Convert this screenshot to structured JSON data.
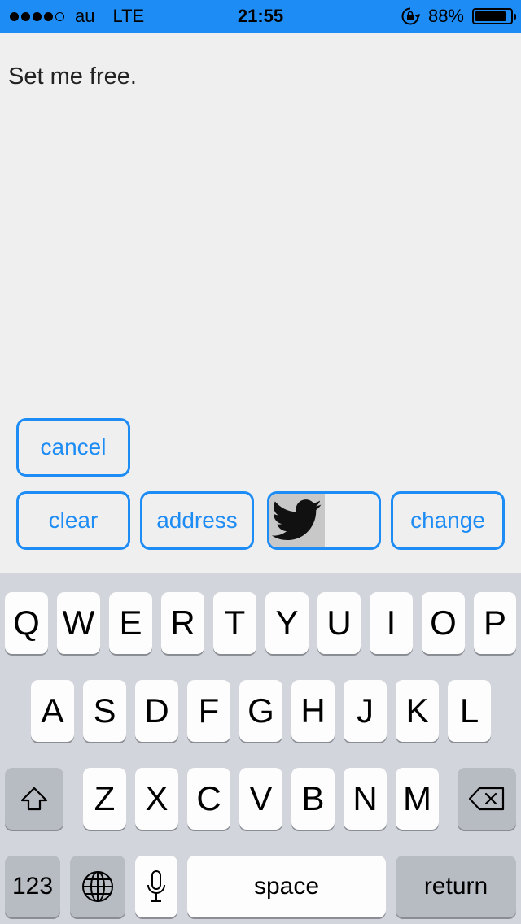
{
  "status_bar": {
    "carrier": "au",
    "network": "LTE",
    "time": "21:55",
    "battery": "88%",
    "battery_level": 0.88,
    "signal_dots_filled": 4,
    "signal_dots_total": 5
  },
  "note": {
    "text": "Set me free."
  },
  "actions": {
    "cancel": "cancel",
    "clear": "clear",
    "address": "address",
    "change": "change",
    "twitter_icon": "twitter-bird-icon"
  },
  "keyboard": {
    "row1": [
      "Q",
      "W",
      "E",
      "R",
      "T",
      "Y",
      "U",
      "I",
      "O",
      "P"
    ],
    "row2": [
      "A",
      "S",
      "D",
      "F",
      "G",
      "H",
      "J",
      "K",
      "L"
    ],
    "row3": [
      "Z",
      "X",
      "C",
      "V",
      "B",
      "N",
      "M"
    ],
    "numbers": "123",
    "space": "space",
    "return": "return",
    "icons": {
      "shift": "shift-icon",
      "delete": "delete-icon",
      "globe": "globe-icon",
      "mic": "microphone-icon"
    }
  },
  "colors": {
    "accent": "#1e8cf5",
    "background": "#efefef",
    "keyboard_bg": "#d2d5db"
  }
}
